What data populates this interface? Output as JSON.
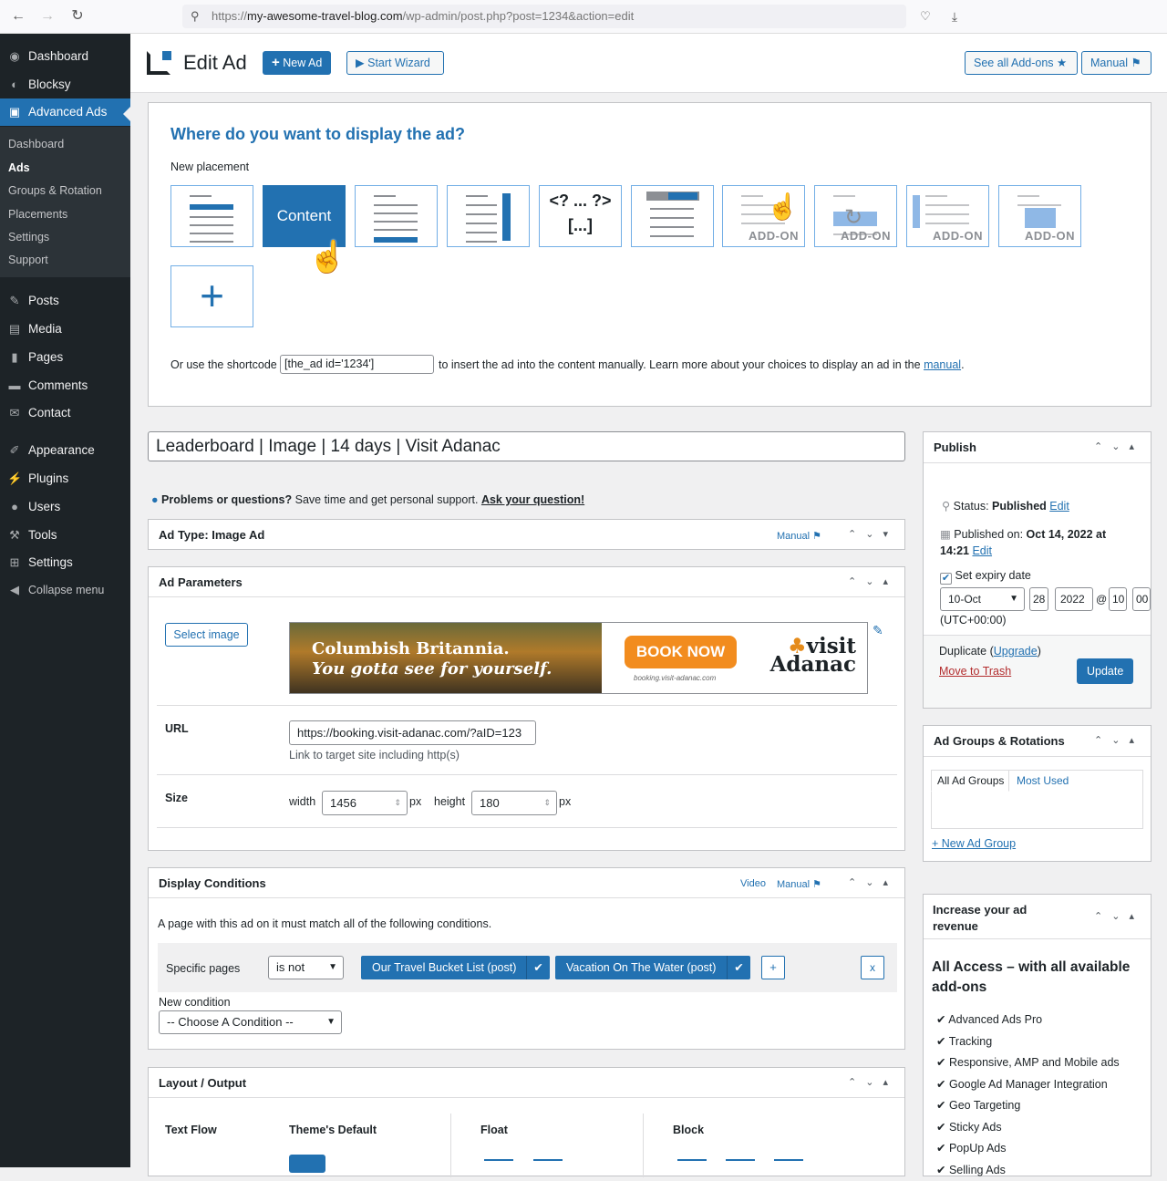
{
  "browser": {
    "url_prefix": "https://",
    "url_domain": "my-awesome-travel-blog.com",
    "url_path": "/wp-admin/post.php?post=1234&action=edit"
  },
  "sidebar": {
    "top_items": [
      {
        "label": "Dashboard",
        "icon": "dashboard-icon"
      },
      {
        "label": "Blocksy",
        "icon": "blocksy-icon"
      },
      {
        "label": "Advanced Ads",
        "icon": "advanced-ads-icon"
      }
    ],
    "submenu": [
      "Dashboard",
      "Ads",
      "Groups & Rotation",
      "Placements",
      "Settings",
      "Support"
    ],
    "items": [
      {
        "label": "Posts",
        "icon": "pin-icon"
      },
      {
        "label": "Media",
        "icon": "media-icon"
      },
      {
        "label": "Pages",
        "icon": "pages-icon"
      },
      {
        "label": "Comments",
        "icon": "comment-icon"
      },
      {
        "label": "Contact",
        "icon": "mail-icon"
      },
      {
        "label": "Appearance",
        "icon": "brush-icon"
      },
      {
        "label": "Plugins",
        "icon": "plug-icon"
      },
      {
        "label": "Users",
        "icon": "user-icon"
      },
      {
        "label": "Tools",
        "icon": "wrench-icon"
      },
      {
        "label": "Settings",
        "icon": "settings-icon"
      },
      {
        "label": "Collapse menu",
        "icon": "collapse-icon"
      }
    ]
  },
  "header": {
    "title": "Edit Ad",
    "new_ad": "New Ad",
    "start_wizard": "Start Wizard",
    "see_addons": "See all Add-ons",
    "manual": "Manual"
  },
  "placement": {
    "heading": "Where do you want to display the ad?",
    "new_placement": "New placement",
    "content_label": "Content",
    "php_line1": "<? ... ?>",
    "php_line2": "[...]",
    "addon_label": "ADD-ON",
    "shortcode_prefix": "Or use the shortcode",
    "shortcode_value": "[the_ad id='1234']",
    "shortcode_suffix": "to insert the ad into the content manually. Learn more about your choices to display an ad in the",
    "manual_link": "manual",
    "period": "."
  },
  "ad": {
    "title": "Leaderboard | Image | 14 days | Visit Adanac",
    "help_bold": "Problems or questions?",
    "help_text": "Save time and get personal support.",
    "help_link": "Ask your question!",
    "ad_type": "Ad Type: Image Ad",
    "manual": "Manual",
    "params_title": "Ad Parameters",
    "select_image": "Select image",
    "banner_line1": "Columbish Britannia.",
    "banner_line2": "You gotta see for yourself.",
    "book_now": "BOOK NOW",
    "booking_url": "booking.visit-adanac.com",
    "brand1": "visit",
    "brand2": "Adanac",
    "url_label": "URL",
    "url_value": "https://booking.visit-adanac.com/?aID=123",
    "url_hint": "Link to target site including http(s)",
    "size_label": "Size",
    "width_label": "width",
    "width_value": "1456",
    "height_label": "height",
    "height_value": "180",
    "px": "px"
  },
  "display_conditions": {
    "title": "Display Conditions",
    "video": "Video",
    "manual": "Manual",
    "desc": "A page with this ad on it must match all of the following conditions.",
    "specific_pages": "Specific pages",
    "operator": "is not",
    "chip1": "Our Travel Bucket List (post)",
    "chip2": "Vacation On The Water (post)",
    "plus": "+",
    "remove": "x",
    "new_condition": "New condition",
    "choose": "-- Choose A Condition --"
  },
  "layout": {
    "title": "Layout / Output",
    "text_flow": "Text Flow",
    "themes_default": "Theme's Default",
    "float": "Float",
    "block": "Block"
  },
  "publish": {
    "title": "Publish",
    "status_label": "Status:",
    "status_value": "Published",
    "edit": "Edit",
    "published_on_label": "Published on:",
    "published_on_value": "Oct 14, 2022 at",
    "published_time": "14:21",
    "expiry_label": "Set expiry date",
    "month": "10-Oct",
    "day": "28",
    "year": "2022",
    "at": "@",
    "hour": "10",
    "minute": "00",
    "timezone": "(UTC+00:00)",
    "duplicate": "Duplicate",
    "upgrade": "Upgrade",
    "trash": "Move to Trash",
    "update": "Update"
  },
  "groups": {
    "title": "Ad Groups & Rotations",
    "tab_all": "All Ad Groups",
    "tab_used": "Most Used",
    "new_group": "+ New Ad Group"
  },
  "revenue": {
    "title_line1": "Increase your ad",
    "title_line2": "revenue",
    "headline_line1": "All Access – with all available",
    "headline_line2": "add-ons",
    "features": [
      "Advanced Ads Pro",
      "Tracking",
      "Responsive, AMP and Mobile ads",
      "Google Ad Manager Integration",
      "Geo Targeting",
      "Sticky Ads",
      "PopUp Ads",
      "Selling Ads"
    ]
  },
  "colors": {
    "accent": "#2271b1",
    "sidebar": "#1d2327",
    "danger": "#b32d2e"
  }
}
